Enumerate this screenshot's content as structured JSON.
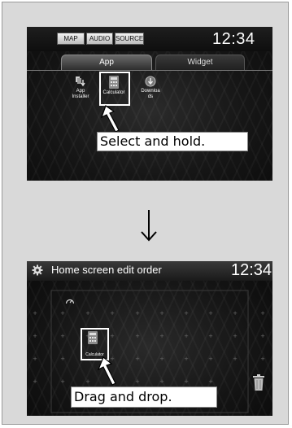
{
  "screen1": {
    "topbar": {
      "buttons": [
        "MAP",
        "AUDIO",
        "SOURCE"
      ],
      "clock": "12:34"
    },
    "tabs": [
      "App",
      "Widget"
    ],
    "active_tab": "App",
    "apps": [
      {
        "label_line1": "App",
        "label_line2": "Installer",
        "icon": "app-installer-icon"
      },
      {
        "label_line1": "Calculator",
        "label_line2": "",
        "icon": "calculator-icon"
      },
      {
        "label_line1": "Downloa",
        "label_line2": "ds",
        "icon": "download-icon"
      }
    ],
    "callout": "Select and hold."
  },
  "arrow": {
    "icon": "down-arrow-icon"
  },
  "screen2": {
    "title": "Home screen edit order",
    "clock": "12:34",
    "calculator_label": "Calculator",
    "callout": "Drag and drop.",
    "icons": [
      "gear-icon",
      "speedometer-icon",
      "calculator-icon",
      "trash-icon"
    ]
  }
}
